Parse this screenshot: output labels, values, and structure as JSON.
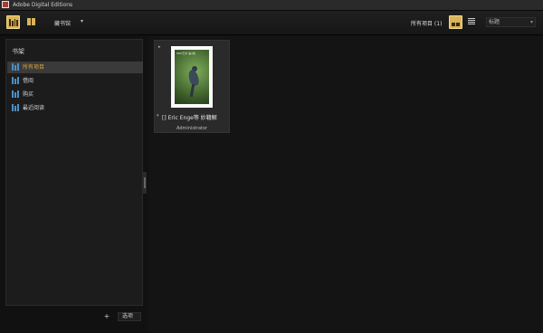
{
  "window": {
    "title": "Adobe Digital Editions"
  },
  "toolbar": {
    "library_dropdown": "藏书馆",
    "all_items": "所有项目 (1)",
    "sort_value": "标题"
  },
  "sidebar": {
    "heading": "书架",
    "items": [
      {
        "label": "所有项目"
      },
      {
        "label": "借阅"
      },
      {
        "label": "购买"
      },
      {
        "label": "最近阅读"
      }
    ],
    "add_label": "+",
    "options_label": "选项"
  },
  "books": [
    {
      "title": "[] Eric Enge等 妙籍解",
      "author": "Administrator",
      "cover_text": "SEO艺术 第2版"
    }
  ],
  "icons": {
    "library_grid": "bookshelf-icon",
    "book_view": "book-view-icon",
    "grid_view": "grid-view-icon",
    "list_view": "list-view-icon",
    "shelf": "shelf-icon"
  },
  "colors": {
    "accent": "#d9b55a",
    "selected_text": "#e0a33a",
    "shelf_icon": "#4a8fc8"
  }
}
